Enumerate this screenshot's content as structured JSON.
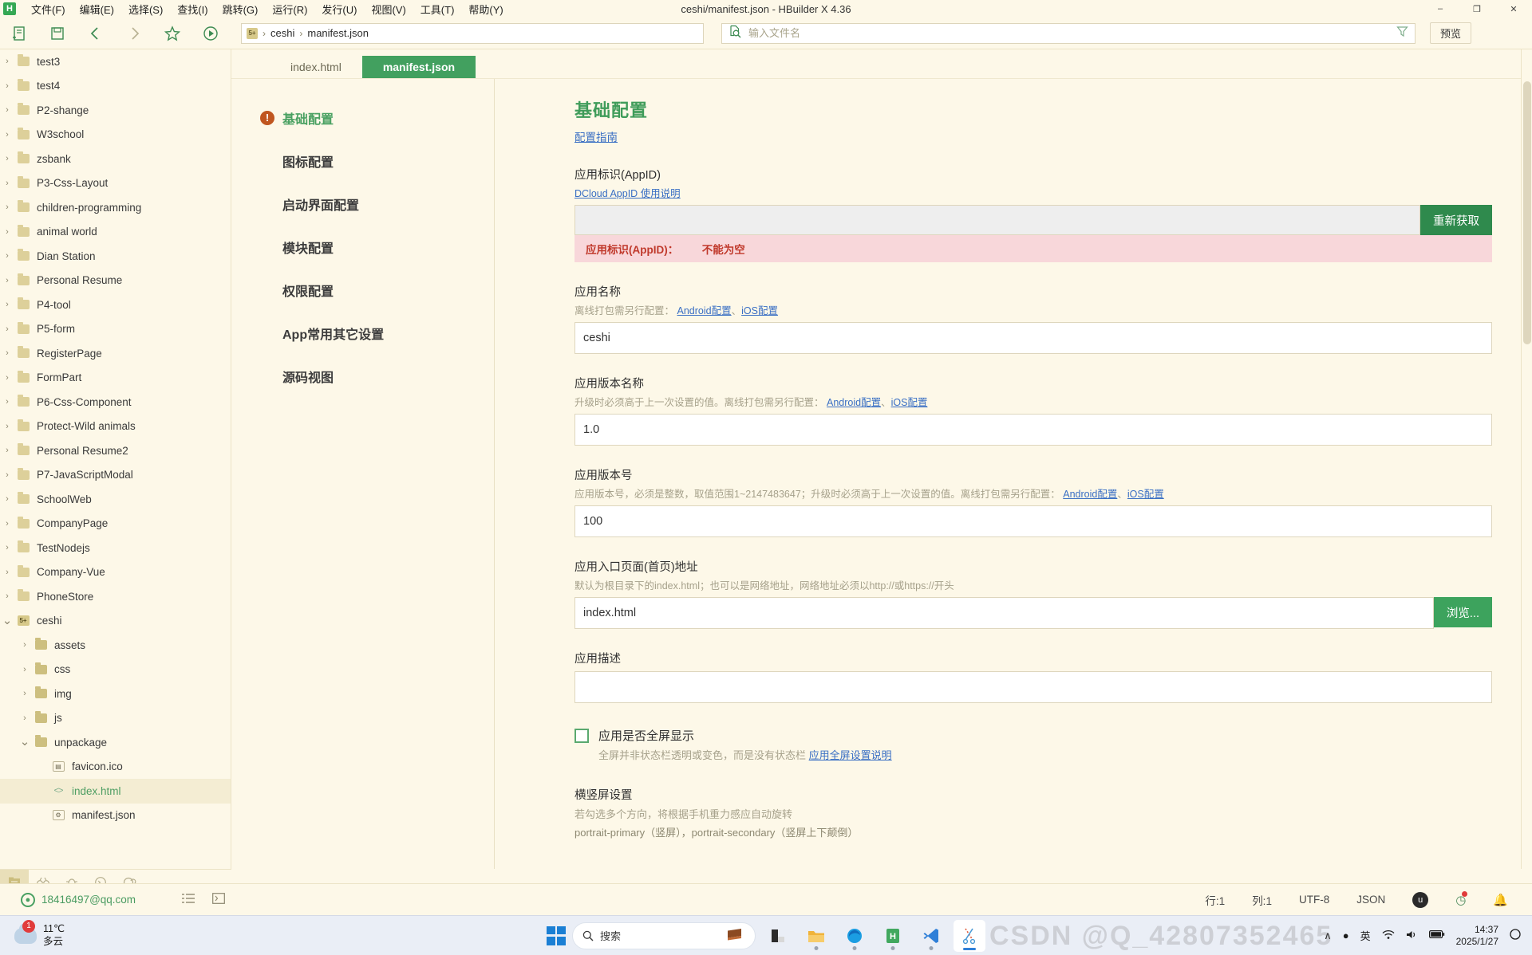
{
  "window": {
    "title": "ceshi/manifest.json - HBuilder X 4.36",
    "logo_letter": "H",
    "controls": {
      "minimize": "–",
      "maximize": "❐",
      "close": "✕"
    }
  },
  "menubar": {
    "items": [
      "文件(F)",
      "编辑(E)",
      "选择(S)",
      "查找(I)",
      "跳转(G)",
      "运行(R)",
      "发行(U)",
      "视图(V)",
      "工具(T)",
      "帮助(Y)"
    ]
  },
  "toolbar": {
    "icons": [
      "new-file-icon",
      "save-icon",
      "back-icon",
      "forward-icon",
      "favorite-icon",
      "run-icon"
    ],
    "breadcrumb": {
      "project_badge": "5+",
      "segments": [
        "ceshi",
        "manifest.json"
      ],
      "separator": "›"
    },
    "search": {
      "placeholder": "输入文件名",
      "value": "",
      "icon": "file-search-icon",
      "filter_icon": "filter-icon"
    },
    "preview_label": "预览"
  },
  "filetree": {
    "items": [
      {
        "label": "test3",
        "type": "folder",
        "depth": 0,
        "expanded": false
      },
      {
        "label": "test4",
        "type": "folder",
        "depth": 0,
        "expanded": false
      },
      {
        "label": "P2-shange",
        "type": "folder",
        "depth": 0,
        "expanded": false
      },
      {
        "label": "W3school",
        "type": "folder",
        "depth": 0,
        "expanded": false
      },
      {
        "label": "zsbank",
        "type": "folder",
        "depth": 0,
        "expanded": false
      },
      {
        "label": "P3-Css-Layout",
        "type": "folder",
        "depth": 0,
        "expanded": false
      },
      {
        "label": "children-programming",
        "type": "folder",
        "depth": 0,
        "expanded": false
      },
      {
        "label": "animal world",
        "type": "folder",
        "depth": 0,
        "expanded": false
      },
      {
        "label": "Dian Station",
        "type": "folder",
        "depth": 0,
        "expanded": false
      },
      {
        "label": "Personal Resume",
        "type": "folder",
        "depth": 0,
        "expanded": false
      },
      {
        "label": "P4-tool",
        "type": "folder",
        "depth": 0,
        "expanded": false
      },
      {
        "label": "P5-form",
        "type": "folder",
        "depth": 0,
        "expanded": false
      },
      {
        "label": "RegisterPage",
        "type": "folder",
        "depth": 0,
        "expanded": false
      },
      {
        "label": "FormPart",
        "type": "folder",
        "depth": 0,
        "expanded": false
      },
      {
        "label": "P6-Css-Component",
        "type": "folder",
        "depth": 0,
        "expanded": false
      },
      {
        "label": "Protect-Wild animals",
        "type": "folder",
        "depth": 0,
        "expanded": false
      },
      {
        "label": "Personal Resume2",
        "type": "folder",
        "depth": 0,
        "expanded": false
      },
      {
        "label": "P7-JavaScriptModal",
        "type": "folder",
        "depth": 0,
        "expanded": false
      },
      {
        "label": "SchoolWeb",
        "type": "folder",
        "depth": 0,
        "expanded": false
      },
      {
        "label": "CompanyPage",
        "type": "folder",
        "depth": 0,
        "expanded": false
      },
      {
        "label": "TestNodejs",
        "type": "folder",
        "depth": 0,
        "expanded": false
      },
      {
        "label": "Company-Vue",
        "type": "folder",
        "depth": 0,
        "expanded": false
      },
      {
        "label": "PhoneStore",
        "type": "folder",
        "depth": 0,
        "expanded": false
      },
      {
        "label": "ceshi",
        "type": "project",
        "badge": "5+",
        "depth": 0,
        "expanded": true
      },
      {
        "label": "assets",
        "type": "folder-solid",
        "depth": 1,
        "expanded": false
      },
      {
        "label": "css",
        "type": "folder-solid",
        "depth": 1,
        "expanded": false
      },
      {
        "label": "img",
        "type": "folder-solid",
        "depth": 1,
        "expanded": false
      },
      {
        "label": "js",
        "type": "folder-solid",
        "depth": 1,
        "expanded": false
      },
      {
        "label": "unpackage",
        "type": "folder-solid",
        "depth": 1,
        "expanded": true
      },
      {
        "label": "favicon.ico",
        "type": "image",
        "depth": 2
      },
      {
        "label": "index.html",
        "type": "html",
        "depth": 2,
        "selected": true
      },
      {
        "label": "manifest.json",
        "type": "json",
        "depth": 2
      }
    ],
    "bottom_icons": [
      "project-icon",
      "search-bug-icon",
      "debug-icon",
      "terminal-icon",
      "cloud-icon"
    ]
  },
  "tabs": [
    {
      "label": "index.html",
      "active": false
    },
    {
      "label": "manifest.json",
      "active": true
    }
  ],
  "config_nav": {
    "items": [
      {
        "label": "基础配置",
        "active": true,
        "warning": true,
        "warning_mark": "!"
      },
      {
        "label": "图标配置",
        "active": false,
        "warning": false
      },
      {
        "label": "启动界面配置",
        "active": false,
        "warning": false
      },
      {
        "label": "模块配置",
        "active": false,
        "warning": false
      },
      {
        "label": "权限配置",
        "active": false,
        "warning": false
      },
      {
        "label": "App常用其它设置",
        "active": false,
        "warning": false
      },
      {
        "label": "源码视图",
        "active": false,
        "warning": false
      }
    ]
  },
  "config": {
    "heading": "基础配置",
    "guide_link": "配置指南",
    "appid": {
      "label": "应用标识(AppID)",
      "link": "DCloud AppID 使用说明",
      "value": "",
      "button": "重新获取",
      "error_field": "应用标识(AppID)：",
      "error_msg": "不能为空"
    },
    "appname": {
      "label": "应用名称",
      "hint_prefix": "离线打包需另行配置：",
      "links": [
        "Android配置",
        "iOS配置"
      ],
      "value": "ceshi"
    },
    "versionname": {
      "label": "应用版本名称",
      "hint_prefix": "升级时必须高于上一次设置的值。离线打包需另行配置：",
      "links": [
        "Android配置",
        "iOS配置"
      ],
      "value": "1.0"
    },
    "versioncode": {
      "label": "应用版本号",
      "hint_prefix": "应用版本号，必须是整数，取值范围1~2147483647；升级时必须高于上一次设置的值。离线打包需另行配置：",
      "links": [
        "Android配置",
        "iOS配置"
      ],
      "value": "100"
    },
    "entrypage": {
      "label": "应用入口页面(首页)地址",
      "hint": "默认为根目录下的index.html；也可以是网络地址，网络地址必须以http://或https://开头",
      "value": "index.html",
      "button": "浏览..."
    },
    "description": {
      "label": "应用描述",
      "value": ""
    },
    "fullscreen": {
      "label": "应用是否全屏显示",
      "checked": false,
      "hint_prefix": "全屏并非状态栏透明或变色，而是没有状态栏",
      "link": "应用全屏设置说明"
    },
    "orientation": {
      "label": "横竖屏设置",
      "hint": "若勾选多个方向，将根据手机重力感应自动旋转",
      "line2": "portrait-primary（竖屏），portrait-secondary（竖屏上下颠倒）"
    }
  },
  "statusbar": {
    "email": "18416497@qq.com",
    "line": "行:1",
    "column": "列:1",
    "encoding": "UTF-8",
    "language": "JSON",
    "icons": [
      "outline-icon",
      "terminal-icon",
      "uni-badge",
      "update-icon",
      "bell-icon"
    ]
  },
  "taskbar": {
    "weather": {
      "temperature": "11℃",
      "description": "多云",
      "badge": "1"
    },
    "search_placeholder": "搜索",
    "clock": {
      "time": "14:37",
      "date": "2025/1/27"
    },
    "tray": {
      "chevron": "∧",
      "ime": "英"
    },
    "apps": [
      "file-explorer-icon",
      "folder-icon",
      "edge-icon",
      "hbuilder-icon",
      "vscode-icon",
      "snipping-tool-icon"
    ],
    "watermark": "CSDN @Q_42807352465"
  }
}
